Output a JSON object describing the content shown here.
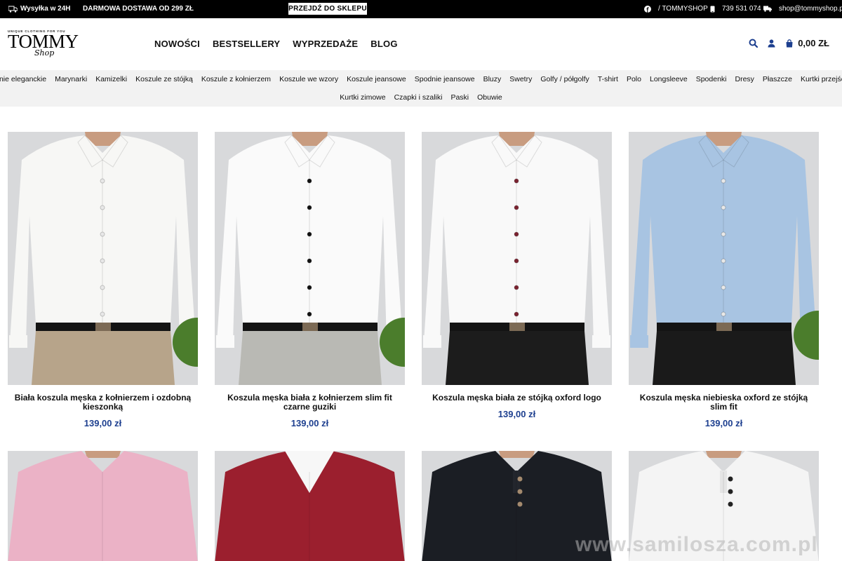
{
  "topbar": {
    "shipping": "Wysyłka w 24H",
    "free_delivery": "DARMOWA DOSTAWA OD 299 ZŁ",
    "shop_button": "PRZEJDŹ DO SKLEPU",
    "facebook": "/ TOMMYSHOP",
    "phone": "739 531 074",
    "email": "shop@tommyshop.pl"
  },
  "logo": {
    "tagline": "UNIQUE CLOTHING FOR YOU",
    "main": "TOMMY",
    "script": "Shop"
  },
  "nav": {
    "items": [
      "NOWOŚCI",
      "BESTSELLERY",
      "WYPRZEDAŻE",
      "BLOG"
    ]
  },
  "header": {
    "cart_total": "0,00 ZŁ"
  },
  "categories": {
    "row1": [
      "Spodnie eleganckie",
      "Marynarki",
      "Kamizelki",
      "Koszule ze stójką",
      "Koszule z kołnierzem",
      "Koszule we wzory",
      "Koszule jeansowe",
      "Spodnie jeansowe",
      "Bluzy",
      "Swetry",
      "Golfy / półgolfy",
      "T-shirt",
      "Polo",
      "Longsleeve",
      "Spodenki",
      "Dresy",
      "Płaszcze",
      "Kurtki przejściowe"
    ],
    "row2": [
      "Kurtki zimowe",
      "Czapki i szaliki",
      "Paski",
      "Obuwie"
    ]
  },
  "products": [
    {
      "name": "Biała koszula męska z kołnierzem i ozdobną kieszonką",
      "price": "139,00 zł",
      "shirt": "#f7f7f5",
      "pants": "#b7a48a"
    },
    {
      "name": "Koszula męska biała z kołnierzem slim fit czarne guziki",
      "price": "139,00 zł",
      "shirt": "#fafafa",
      "pants": "#b9b9b4"
    },
    {
      "name": "Koszula męska biała ze stójką oxford logo",
      "price": "139,00 zł",
      "shirt": "#f9f9f9",
      "pants": "#1c1c1c"
    },
    {
      "name": "Koszula męska niebieska oxford ze stójką slim fit",
      "price": "139,00 zł",
      "shirt": "#a8c4e2",
      "pants": "#1a1a1a"
    },
    {
      "name": "",
      "price": "",
      "shirt": "#ebb2c6",
      "pants": ""
    },
    {
      "name": "",
      "price": "",
      "shirt": "#9b1f2e",
      "pants": ""
    },
    {
      "name": "",
      "price": "",
      "shirt": "#1b1e24",
      "pants": ""
    },
    {
      "name": "",
      "price": "",
      "shirt": "#f4f4f4",
      "pants": ""
    }
  ],
  "watermark": "www.samilosza.com.pl",
  "colors": {
    "accent": "#1d3f8f",
    "topbar": "#000000",
    "catbar": "#f2f2f2"
  }
}
